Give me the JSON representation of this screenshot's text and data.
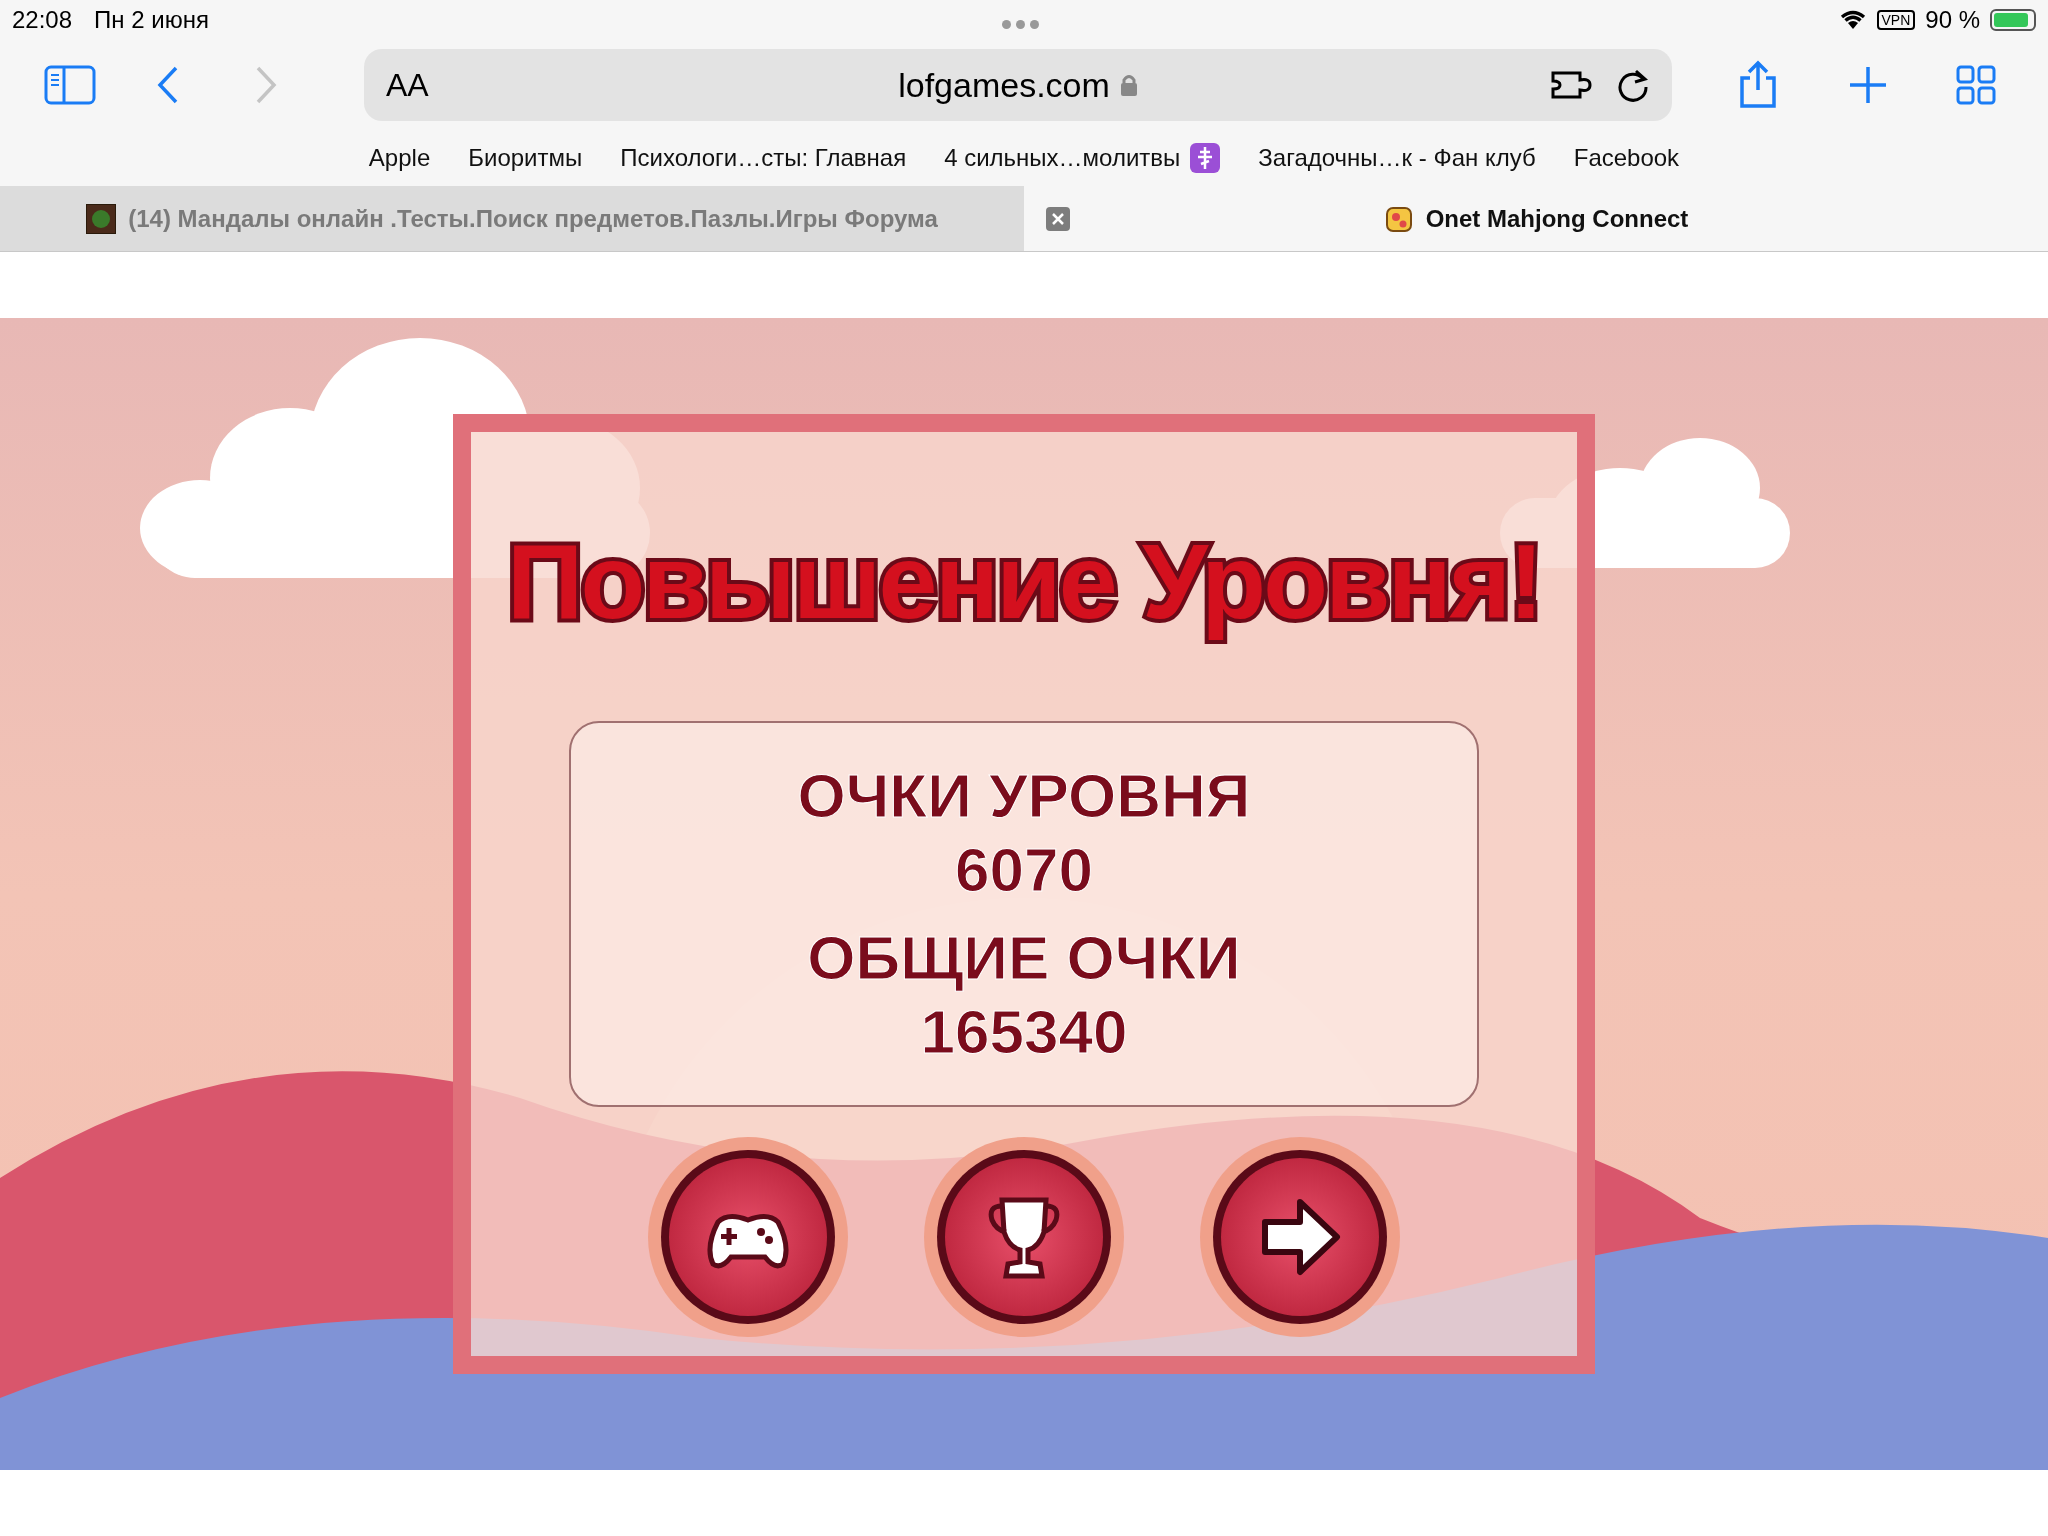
{
  "status_bar": {
    "time": "22:08",
    "date": "Пн 2 июня",
    "vpn": "VPN",
    "battery": "90 %"
  },
  "toolbar": {
    "text_size": "AA",
    "url": "lofgames.com"
  },
  "bookmarks": [
    {
      "label": "Apple",
      "emoji": false
    },
    {
      "label": "Биоритмы",
      "emoji": false
    },
    {
      "label": "Психологи…сты: Главная",
      "emoji": false
    },
    {
      "label": "4 сильных…молитвы",
      "emoji": true
    },
    {
      "label": "Загадочны…к - Фан клуб",
      "emoji": false
    },
    {
      "label": "Facebook",
      "emoji": false
    }
  ],
  "tabs": [
    {
      "title": "(14) Мандалы онлайн .Тесты.Поиск предметов.Пазлы.Игры Форума",
      "selected": false,
      "kind": "tree"
    },
    {
      "title": "Onet Mahjong Connect",
      "selected": true,
      "kind": "toast"
    }
  ],
  "game": {
    "title": "Повышение Уровня!",
    "scores": [
      {
        "label": "ОЧКИ УРОВНЯ",
        "value": "6070"
      },
      {
        "label": "ОБЩИЕ ОЧКИ",
        "value": "165340"
      }
    ],
    "buttons": [
      {
        "kind": "gamepad"
      },
      {
        "kind": "trophy"
      },
      {
        "kind": "next"
      }
    ]
  }
}
